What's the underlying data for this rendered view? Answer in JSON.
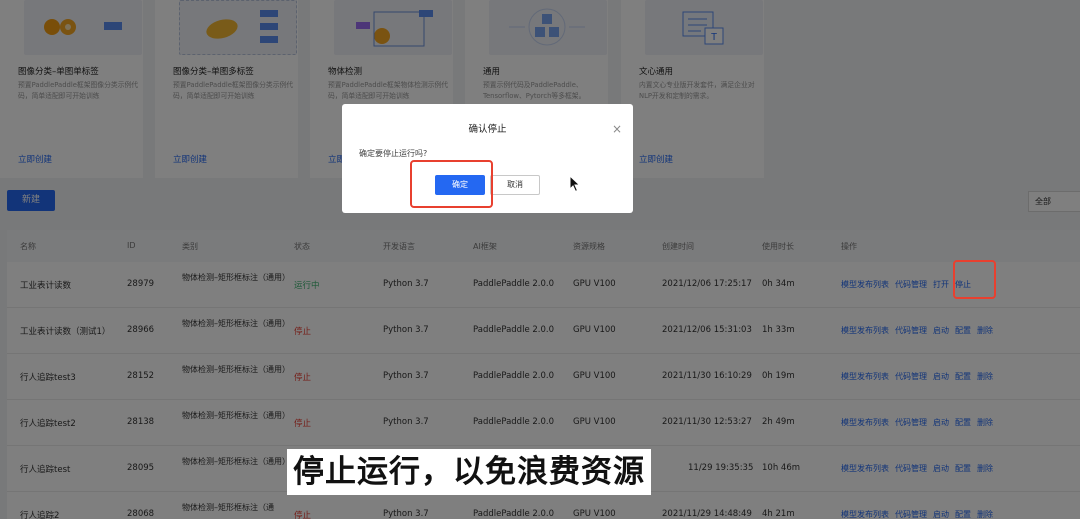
{
  "templates": [
    {
      "title": "图像分类–单图单标签",
      "desc": "预置PaddlePaddle框架图像分类示例代码，简单适配即可开始训练",
      "link": "立即创建",
      "icon": "oranges-icon"
    },
    {
      "title": "图像分类–单图多标签",
      "desc": "预置PaddlePaddle框架图像分类示例代码，简单适配即可开始训练",
      "link": "立即创建",
      "icon": "mango-icon"
    },
    {
      "title": "物体检测",
      "desc": "预置PaddlePaddle框架物体检测示例代码，简单适配即可开始训练",
      "link": "立即创建",
      "icon": "detection-icon"
    },
    {
      "title": "通用",
      "desc": "预置示例代码及PaddlePaddle、Tensorflow、Pytorch等多框架。",
      "link": "",
      "icon": "cubes-icon"
    },
    {
      "title": "文心通用",
      "desc": "内置文心专业版开发套件，满足企业对NLP开发和定制的需求。",
      "link": "立即创建",
      "icon": "text-tool-icon"
    }
  ],
  "toolbar": {
    "new_label": "新建",
    "filter_value": "全部"
  },
  "table": {
    "headers": [
      "名称",
      "ID",
      "类别",
      "状态",
      "开发语言",
      "AI框架",
      "资源规格",
      "创建时间",
      "使用时长",
      "操作"
    ],
    "rows": [
      {
        "name": "工业表计读数",
        "id": "28979",
        "type": "物体检测–矩形框标注（通用）",
        "status": "运行中",
        "lang": "Python 3.7",
        "framework": "PaddlePaddle 2.0.0",
        "spec": "GPU V100",
        "created": "2021/12/06 17:25:17",
        "duration": "0h 34m",
        "ops": [
          "模型发布列表",
          "代码管理",
          "打开",
          "停止"
        ]
      },
      {
        "name": "工业表计读数（测试1）",
        "id": "28966",
        "type": "物体检测–矩形框标注（通用）",
        "status": "停止",
        "lang": "Python 3.7",
        "framework": "PaddlePaddle 2.0.0",
        "spec": "GPU V100",
        "created": "2021/12/06 15:31:03",
        "duration": "1h 33m",
        "ops": [
          "模型发布列表",
          "代码管理",
          "启动",
          "配置",
          "删除"
        ]
      },
      {
        "name": "行人追踪test3",
        "id": "28152",
        "type": "物体检测–矩形框标注（通用）",
        "status": "停止",
        "lang": "Python 3.7",
        "framework": "PaddlePaddle 2.0.0",
        "spec": "GPU V100",
        "created": "2021/11/30 16:10:29",
        "duration": "0h 19m",
        "ops": [
          "模型发布列表",
          "代码管理",
          "启动",
          "配置",
          "删除"
        ]
      },
      {
        "name": "行人追踪test2",
        "id": "28138",
        "type": "物体检测–矩形框标注（通用）",
        "status": "停止",
        "lang": "Python 3.7",
        "framework": "PaddlePaddle 2.0.0",
        "spec": "GPU V100",
        "created": "2021/11/30 12:53:27",
        "duration": "2h 49m",
        "ops": [
          "模型发布列表",
          "代码管理",
          "启动",
          "配置",
          "删除"
        ]
      },
      {
        "name": "行人追踪test",
        "id": "28095",
        "type": "物体检测–矩形框标注（通用）",
        "status": "",
        "lang": "",
        "framework": "",
        "spec": "",
        "created": "11/29 19:35:35",
        "duration": "10h 46m",
        "ops": [
          "模型发布列表",
          "代码管理",
          "启动",
          "配置",
          "删除"
        ]
      },
      {
        "name": "行人追踪2",
        "id": "28068",
        "type": "物体检测–矩形框标注（通",
        "status": "停止",
        "lang": "Python 3.7",
        "framework": "PaddlePaddle 2.0.0",
        "spec": "GPU V100",
        "created": "2021/11/29 14:48:49",
        "duration": "4h 21m",
        "ops": [
          "模型发布列表",
          "代码管理",
          "启动",
          "配置",
          "删除"
        ]
      }
    ]
  },
  "dialog": {
    "title": "确认停止",
    "message": "确定要停止运行吗?",
    "ok_label": "确定",
    "cancel_label": "取消",
    "close_icon": "close-icon"
  },
  "subtitle": "停止运行，以免浪费资源",
  "colors": {
    "primary": "#2468f2",
    "running": "#3cb371",
    "stopped": "#e83a2f",
    "highlight": "#e8402f"
  }
}
